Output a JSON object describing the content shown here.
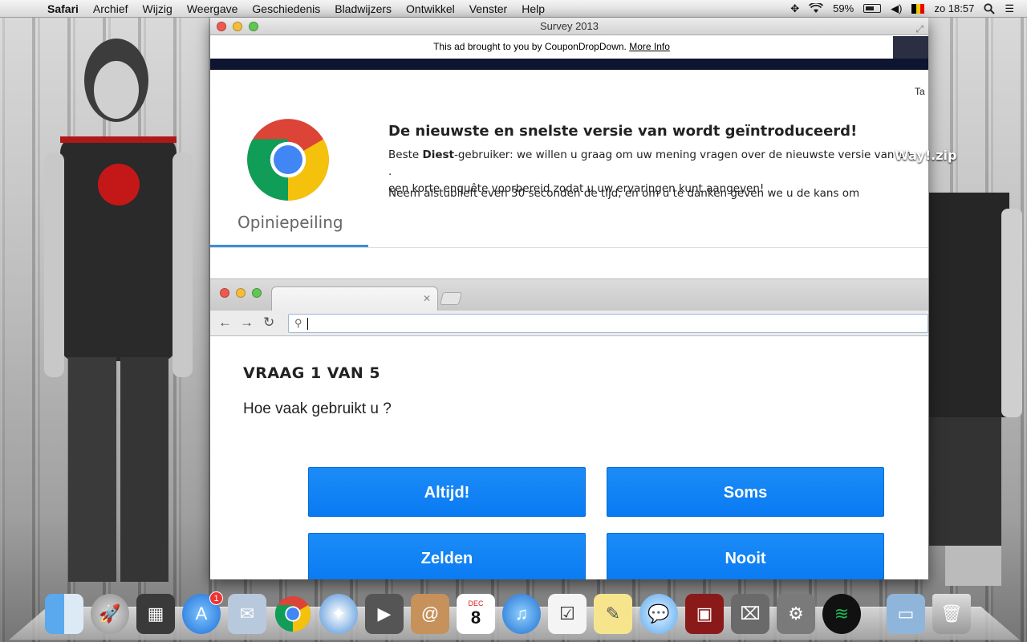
{
  "menubar": {
    "apple": "",
    "items": [
      "Safari",
      "Archief",
      "Wijzig",
      "Weergave",
      "Geschiedenis",
      "Bladwijzers",
      "Ontwikkel",
      "Venster",
      "Help"
    ],
    "battery": "59%",
    "clock": "zo 18:57"
  },
  "window": {
    "title": "Survey 2013",
    "ad_text": "This ad brought to you by CouponDropDown.",
    "ad_link": "More Info"
  },
  "header": {
    "corner_text": "Ta",
    "brand": "Opiniepeiling",
    "headline": "De nieuwste en snelste versie van wordt geïntroduceerd!",
    "body_prefix": "Beste ",
    "body_bold": "Diest",
    "body_rest": "-gebruiker: we willen u graag om uw mening vragen over de nieuwste versie van en .",
    "overlay_zip": "Way!.zip",
    "body_line2": "een korte enquête voorbereid zodat u uw ervaringen kunt aangeven!",
    "body_para2": "Neem alstublieft even 30 seconden de tijd, en om u te danken geven we u de kans om"
  },
  "survey": {
    "question_number": "VRAAG 1 VAN 5",
    "question_text": "Hoe vaak gebruikt u ?",
    "answers": [
      "Altijd!",
      "Soms",
      "Zelden",
      "Nooit"
    ]
  },
  "dock": {
    "calendar_month": "DEC",
    "calendar_day": "8",
    "appstore_badge": "1"
  },
  "colors": {
    "accent_blue": "#0a7af3",
    "underline_blue": "#3a8fd9",
    "navy": "#0e1530"
  }
}
